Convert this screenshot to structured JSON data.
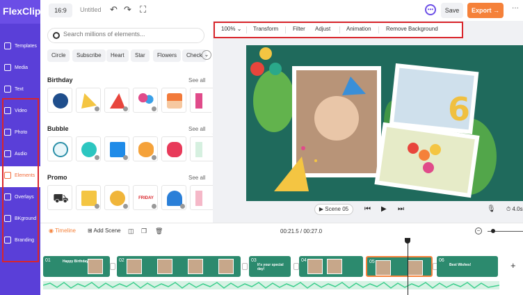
{
  "app": {
    "logo_rest": "lexClip",
    "logo_f": "F"
  },
  "sidebar": {
    "items": [
      {
        "label": "Templates",
        "icon": "templates-icon"
      },
      {
        "label": "Media",
        "icon": "media-icon"
      },
      {
        "label": "Text",
        "icon": "text-icon"
      },
      {
        "label": "Video",
        "icon": "video-icon"
      },
      {
        "label": "Photo",
        "icon": "photo-icon"
      },
      {
        "label": "Audio",
        "icon": "audio-icon"
      },
      {
        "label": "Elements",
        "icon": "elements-icon",
        "active": true
      },
      {
        "label": "Overlays",
        "icon": "overlays-icon"
      },
      {
        "label": "BKground",
        "icon": "background-icon"
      },
      {
        "label": "Branding",
        "icon": "branding-icon"
      }
    ]
  },
  "topbar": {
    "ratio": "16:9",
    "title": "Untitled",
    "save": "Save",
    "export": "Export →",
    "more": "···"
  },
  "panel": {
    "search_placeholder": "Search millions of elements...",
    "chips": [
      "Circle",
      "Subscribe",
      "Heart",
      "Star",
      "Flowers",
      "Check"
    ],
    "sections": [
      {
        "title": "Birthday",
        "see_all": "See all"
      },
      {
        "title": "Bubble",
        "see_all": "See all"
      },
      {
        "title": "Promo",
        "see_all": "See all"
      }
    ],
    "promo_friday": "FRIDAY"
  },
  "toolbar": {
    "zoom": "100%",
    "items": [
      "Transform",
      "Filter",
      "Adjust",
      "Animation",
      "Remove Background"
    ]
  },
  "stage": {
    "big_number": "6"
  },
  "player": {
    "scene": "Scene 05",
    "duration": "4.0s"
  },
  "timeline": {
    "label": "Timeline",
    "add_scene": "Add Scene",
    "time": "00:21.5 / 00:27.0"
  },
  "clips": [
    {
      "num": "01",
      "text": "Happy Birthday"
    },
    {
      "num": "02",
      "text": ""
    },
    {
      "num": "03",
      "text": "It's your special day!"
    },
    {
      "num": "04",
      "text": ""
    },
    {
      "num": "05",
      "text": ""
    },
    {
      "num": "06",
      "text": "Best Wishes!"
    }
  ],
  "colors": {
    "sidebar": "#5a3fd8",
    "accent": "#f5813a",
    "highlight": "#d9252b",
    "stage": "#1f6a5c"
  }
}
